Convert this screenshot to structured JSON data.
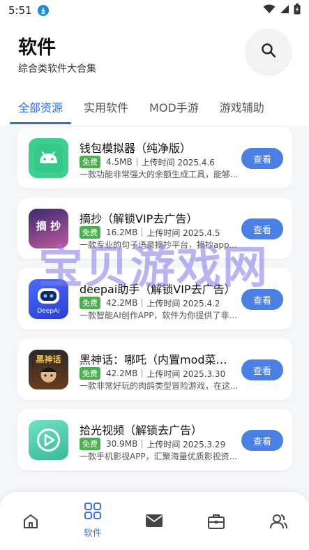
{
  "status": {
    "time": "5:51"
  },
  "header": {
    "title": "软件",
    "subtitle": "综合类软件大合集"
  },
  "tabs": [
    {
      "label": "全部资源",
      "active": true
    },
    {
      "label": "实用软件",
      "active": false
    },
    {
      "label": "MOD手游",
      "active": false
    },
    {
      "label": "游戏辅助",
      "active": false
    }
  ],
  "apps": [
    {
      "name": "钱包模拟器（纯净版）",
      "badge": "免费",
      "size": "4.5MB",
      "upload": "上传时间 2025.4.6",
      "desc": "一款功能非常强大的余额生成工具，能够...",
      "button": "查看",
      "icon": "android-icon"
    },
    {
      "name": "摘抄（解锁VIP去广告）",
      "badge": "免费",
      "size": "16.2MB",
      "upload": "上传时间 2025.4.5",
      "desc": "一款专业的句子语录摘抄平台，摘抄app...",
      "button": "查看",
      "icon": "zhaochao-icon",
      "icon_text": "摘 抄"
    },
    {
      "name": "deepai助手（解锁VIP去广告）",
      "badge": "免费",
      "size": "42.2MB",
      "upload": "上传时间 2025.4.2",
      "desc": "一款智能AI创作APP，软件为你提供了非...",
      "button": "查看",
      "icon": "deepai-icon",
      "icon_text": "DeepAi"
    },
    {
      "name": "黑神话：哪吒（内置mod菜单）",
      "badge": "免费",
      "size": "42.2MB",
      "upload": "上传时间 2025.3.30",
      "desc": "一款非常好玩的肉鸽类型冒险游戏，在这...",
      "button": "查看",
      "icon": "heishenhua-icon",
      "icon_text": "黑神话"
    },
    {
      "name": "拾光视频（解锁去广告）",
      "badge": "免费",
      "size": "30.9MB",
      "upload": "上传时间 2025.3.29",
      "desc": "一款手机影视APP，汇聚海量优质影视资...",
      "button": "查看",
      "icon": "play-icon"
    }
  ],
  "watermark": "宝贝游戏网",
  "bottom_nav": [
    {
      "label": "",
      "icon": "home-icon",
      "active": false
    },
    {
      "label": "软件",
      "icon": "grid-icon",
      "active": true
    },
    {
      "label": "",
      "icon": "mail-icon",
      "active": false
    },
    {
      "label": "",
      "icon": "toolbox-icon",
      "active": false
    },
    {
      "label": "",
      "icon": "users-icon",
      "active": false
    }
  ],
  "colors": {
    "accent": "#2f6ee4",
    "button": "#4a7fe3",
    "badge": "#4caf50"
  }
}
